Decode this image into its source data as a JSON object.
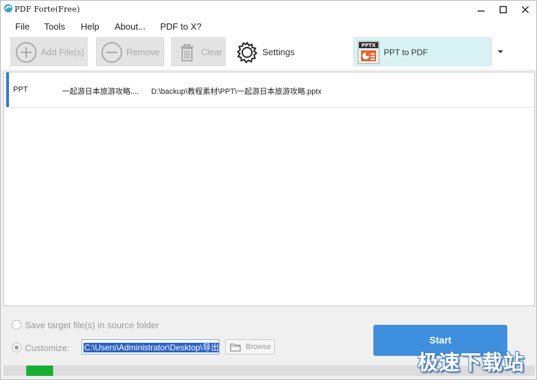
{
  "window": {
    "title": "PDF Forte(Free)"
  },
  "menu": [
    {
      "label": "File"
    },
    {
      "label": "Tools"
    },
    {
      "label": "Help"
    },
    {
      "label": "About..."
    },
    {
      "label": "PDF to X?"
    }
  ],
  "toolbar": {
    "add_files": "Add File(s)",
    "remove": "Remove",
    "clear": "Clear",
    "settings": "Settings",
    "conversion": {
      "selected": "PPT to PDF",
      "icon_badge": "PPTX"
    }
  },
  "files": [
    {
      "type": "PPT",
      "name": "一起游日本旅游攻略....",
      "path": "D:\\backup\\教程素材\\PPT\\一起游日本旅游攻略.pptx"
    }
  ],
  "output": {
    "save_in_source_label": "Save target file(s) in source folder",
    "save_in_source_checked": false,
    "customize_label": "Customize:",
    "customize_checked": true,
    "path_value": "C:\\Users\\Administrator\\Desktop\\导出",
    "browse_label": "Browse"
  },
  "start_label": "Start",
  "progress": {
    "fill_fraction": 0.05
  },
  "watermark": "极速下载站",
  "colors": {
    "accent": "#2a7bd6",
    "start_button": "#3e8fde",
    "progress_fill": "#17b02e",
    "conversion_bg": "#d9f3f5"
  }
}
